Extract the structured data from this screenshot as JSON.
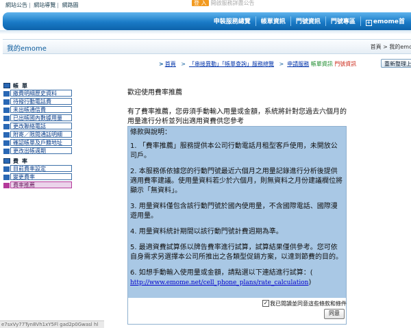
{
  "top_links": [
    "網站公告",
    "網站導覽",
    "網路圖"
  ],
  "login": {
    "button": "登 入",
    "hint": "開啟服務詳盡公告"
  },
  "nav": {
    "items": [
      "申裝服務總覽",
      "帳單資訊",
      "門號資訊",
      "門號專區",
      "emome首"
    ]
  },
  "title_bar": {
    "title": "我的emome",
    "breadcrumb": "首頁 > 我的emo"
  },
  "crumbs": {
    "home": "首頁",
    "series": "「串接異動」「帳單查詢」服務總覽",
    "apply": "申請服務",
    "bill_info": "帳單資訊",
    "number_info": "門號資訊"
  },
  "reset_button": "重新整理上",
  "sidebar": {
    "sections": [
      {
        "label": "帳單",
        "items": [
          "繳費明細歷史資料",
          "待撥行動電話費",
          "未出帳通信費",
          "已出帳國內數據用量",
          "更改聯絡電話",
          "附寄／限閱通話明細",
          "確認帳單及戶籍地址",
          "更改出帳週期"
        ]
      },
      {
        "label": "費率",
        "items": [
          "目前費率設定",
          "變更費率",
          "費率推薦"
        ]
      }
    ],
    "active_item": "費率推薦"
  },
  "main": {
    "heading": "歡迎使用費率推薦",
    "intro": "有了費率推薦，您毋須手動輸入用量或金額，系統將針對您過去六個月的用量進行分析並列出適用資費供您參考"
  },
  "terms": {
    "title": "條款與說明：",
    "paragraphs": [
      "1. 「費率推薦」服務提供本公司行動電話月租型客戶使用，未開放公司戶。",
      "2. 本服務係依據您的行動門號最近六個月之用量記錄進行分析後提供適用費率建議。使用量資料若少於六個月，則無資料之月份建議欄位將顯示「無資料」。",
      "3. 用量資料僅包含該行動門號於國內使用量，不含國際電話、國際漫遊用量。",
      "4. 用量資料統計期間以該行動門號計費週期為準。",
      "5. 最適資費試算係以牌告費率進行試算，試算結果僅供參考。您可依自身需求另選擇本公司所推出之各類型促銷方案，以達到節費的目的。",
      "6. 如想手動輸入使用量或金額，請點選以下連結進行試算：("
    ],
    "url": "http://www.emome.net/cell_phone_plans/rate_calculation",
    "url_tail": ")"
  },
  "agree": {
    "label": "我已閱讀並同意這些條款和條件",
    "checked_mark": "✓",
    "button": "同意"
  },
  "status_bar": "e7sxVy77Tyn8Vh1xY5Fl gad2p0Gwasl hl"
}
